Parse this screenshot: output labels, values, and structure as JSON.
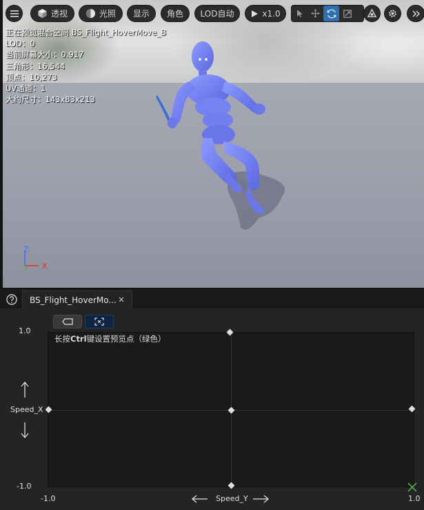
{
  "toolbar": {
    "perspective_label": "透视",
    "lighting_label": "光照",
    "show_label": "显示",
    "character_label": "角色",
    "lod_label": "LOD自动",
    "play_label": "x1.0"
  },
  "stats": {
    "line1": "正在预览混合空间 BS_Flight_HoverMove_B",
    "line2": "LOD：0",
    "line3": "当前屏幕大小：0.917",
    "line4": "三角形：16,544",
    "line5": "顶点：10,273",
    "line6": "UV通道：1",
    "line7": "大约尺寸：143x83x213"
  },
  "gizmo": {
    "z": "Z",
    "x": "X"
  },
  "tab": {
    "label": "BS_Flight_HoverMo...",
    "close": "×"
  },
  "editor": {
    "hint_prefix": "长按",
    "hint_key": "Ctrl",
    "hint_suffix": "键设置预览点（绿色）",
    "y_axis_name": "Speed_X",
    "x_axis_name": "Speed_Y",
    "y_max": "1.0",
    "y_min": "-1.0",
    "x_min": "-1.0",
    "x_max": "1.0"
  },
  "colors": {
    "accent_blue": "#2f6fb0",
    "preview_green": "#4caf50",
    "axis_red": "#e03030",
    "axis_blue": "#3b6cff",
    "axis_green": "#35c035"
  }
}
